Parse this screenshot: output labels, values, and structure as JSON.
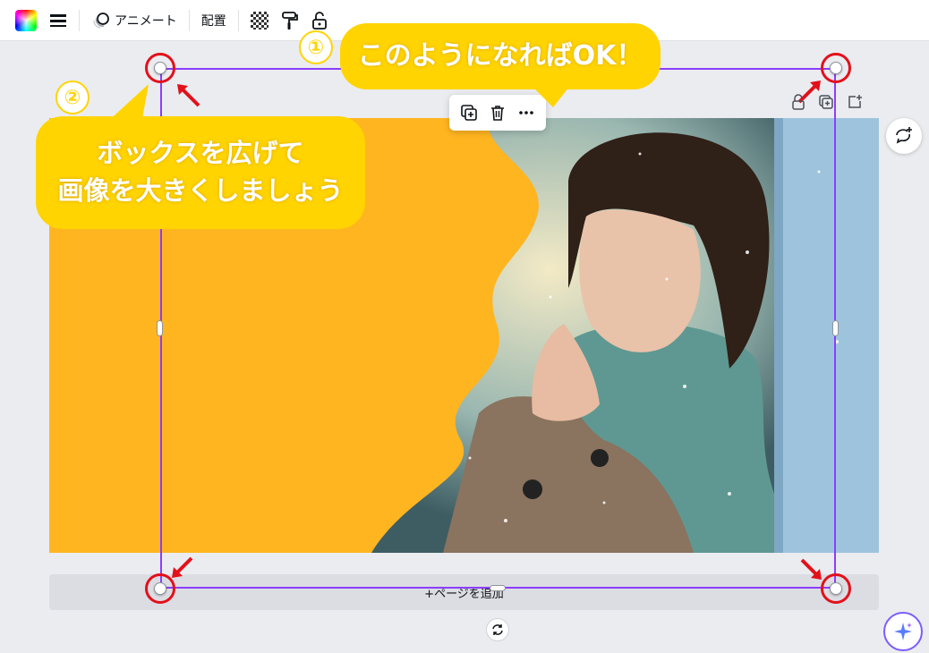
{
  "toolbar": {
    "animate_label": "アニメート",
    "arrange_label": "配置"
  },
  "add_page_label": "+ページを追加",
  "callouts": {
    "step1_number": "①",
    "step1_text": "このようになればOK！",
    "step2_number": "②",
    "step2_line1": "ボックスを広げて",
    "step2_line2": "画像を大きくしましょう"
  },
  "colors": {
    "page_background": "#ffb520",
    "selection": "#8b3dff",
    "callout": "#ffd400",
    "highlight_ring": "#e3101a"
  },
  "icons": {
    "toolbar": [
      "color-swatch-icon",
      "lines-icon",
      "animate-icon",
      "transparency-icon",
      "paint-roller-icon",
      "lock-icon"
    ],
    "float_menu": [
      "duplicate-icon",
      "trash-icon",
      "more-icon"
    ],
    "page_tools": [
      "lock-icon",
      "duplicate-page-icon",
      "add-page-icon"
    ]
  }
}
